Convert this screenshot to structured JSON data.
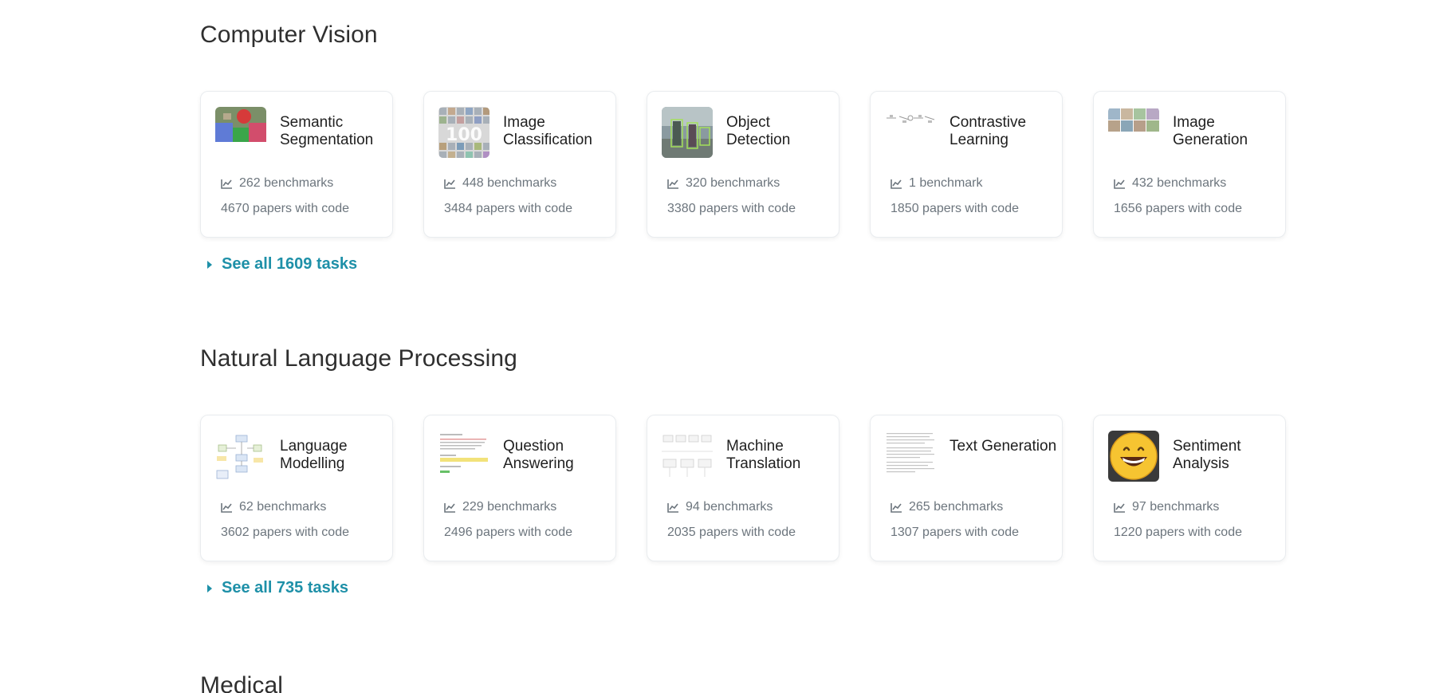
{
  "sections": [
    {
      "title": "Computer Vision",
      "see_all": "See all 1609 tasks",
      "cards": [
        {
          "name": "Semantic Segmentation",
          "benchmarks": "262 benchmarks",
          "papers": "4670 papers with code",
          "thumb": "segmentation-image"
        },
        {
          "name": "Image Classification",
          "benchmarks": "448 benchmarks",
          "papers": "3484 papers with code",
          "thumb": "image-grid-100"
        },
        {
          "name": "Object Detection",
          "benchmarks": "320 benchmarks",
          "papers": "3380 papers with code",
          "thumb": "street-scene-photo"
        },
        {
          "name": "Contrastive Learning",
          "benchmarks": "1 benchmark",
          "papers": "1850 papers with code",
          "thumb": "diagram-thumbnail"
        },
        {
          "name": "Image Generation",
          "benchmarks": "432 benchmarks",
          "papers": "1656 papers with code",
          "thumb": "generated-images-strip"
        }
      ]
    },
    {
      "title": "Natural Language Processing",
      "see_all": "See all 735 tasks",
      "cards": [
        {
          "name": "Language Modelling",
          "benchmarks": "62 benchmarks",
          "papers": "3602 papers with code",
          "thumb": "architecture-diagram"
        },
        {
          "name": "Question Answering",
          "benchmarks": "229 benchmarks",
          "papers": "2496 papers with code",
          "thumb": "qa-text-snippet"
        },
        {
          "name": "Machine Translation",
          "benchmarks": "94 benchmarks",
          "papers": "2035 papers with code",
          "thumb": "seq2seq-diagram"
        },
        {
          "name": "Text Generation",
          "benchmarks": "265 benchmarks",
          "papers": "1307 papers with code",
          "thumb": "text-document"
        },
        {
          "name": "Sentiment Analysis",
          "benchmarks": "97 benchmarks",
          "papers": "1220 papers with code",
          "thumb": "smiley-face-emoji"
        }
      ]
    },
    {
      "title": "Medical"
    }
  ],
  "colors": {
    "link": "#1e90a8",
    "muted": "#6c757d",
    "heading": "#2f2f2f"
  }
}
